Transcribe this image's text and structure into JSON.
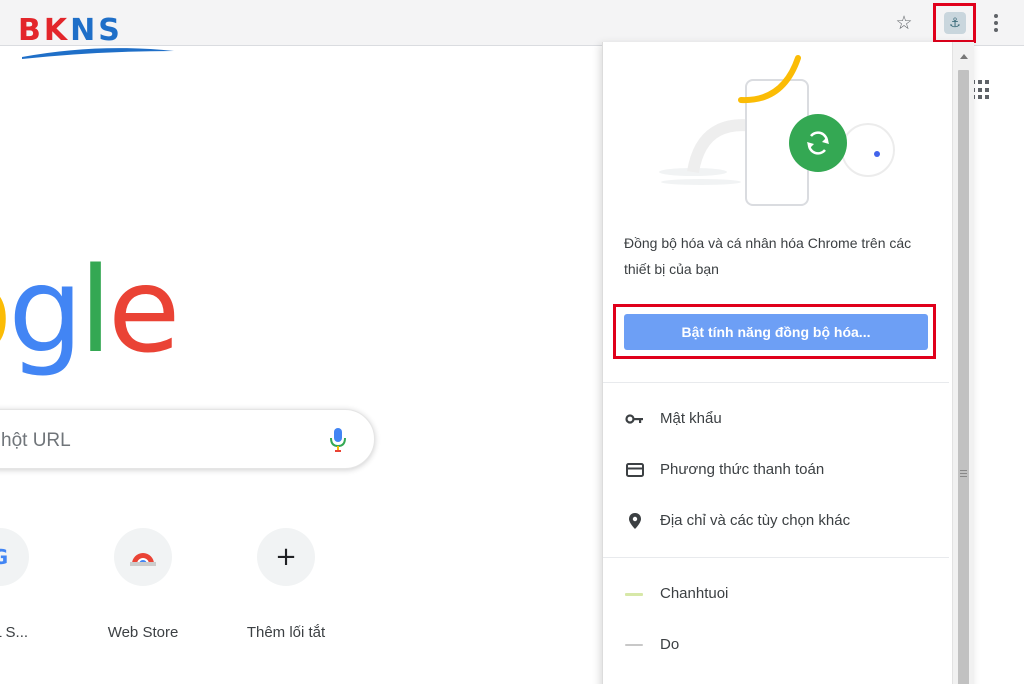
{
  "brand": {
    "logo_text_red": "BK",
    "logo_text_blue": "NS"
  },
  "toolbar": {
    "star_icon": "star-icon",
    "avatar_icon": "profile-avatar-icon",
    "menu_icon": "kebab-menu-icon"
  },
  "ntp": {
    "google_letters": [
      "o",
      "g",
      "l",
      "e"
    ],
    "google_colors": [
      "#fbbc05",
      "#4285f4",
      "#34a853",
      "#ea4335"
    ],
    "search_placeholder": "hột URL",
    "shortcuts": [
      {
        "label": "URL S...",
        "icon": "google-g-icon"
      },
      {
        "label": "Web Store",
        "icon": "chrome-web-store-icon"
      },
      {
        "label": "Thêm lối tắt",
        "icon": "plus-icon",
        "glyph": "+"
      }
    ]
  },
  "sync_popup": {
    "description": "Đồng bộ hóa và cá nhân hóa Chrome trên các thiết bị của bạn",
    "sync_button_label": "Bật tính năng đồng bộ hóa...",
    "menu_items": [
      {
        "label": "Mật khẩu",
        "icon": "key-icon"
      },
      {
        "label": "Phương thức thanh toán",
        "icon": "credit-card-icon"
      },
      {
        "label": "Địa chỉ và các tùy chọn khác",
        "icon": "location-pin-icon"
      }
    ],
    "profiles": [
      {
        "label": "Chanhtuoi",
        "color": "#d7e8a8"
      },
      {
        "label": "Do",
        "color": "#c8c8c8"
      }
    ]
  },
  "colors": {
    "sync_button": "#6d9ff5",
    "highlight_frame": "#e0001b",
    "brand_red": "#e3262b",
    "brand_blue": "#1f6fc8"
  }
}
